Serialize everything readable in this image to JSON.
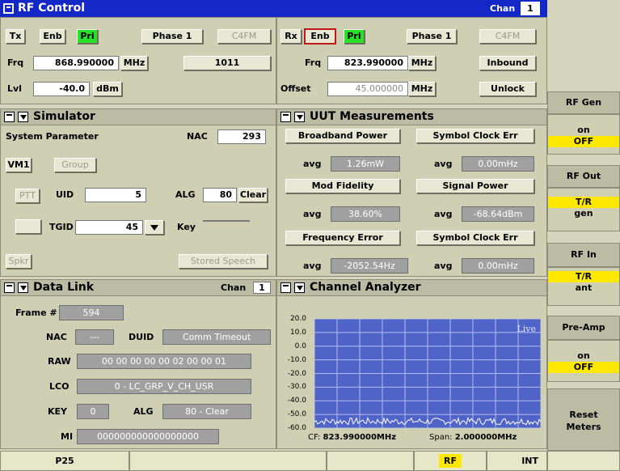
{
  "window": {
    "title": "RF Control",
    "chan_label": "Chan",
    "chan_value": "1"
  },
  "tx": {
    "label": "Tx",
    "enb": "Enb",
    "pri": "Pri",
    "phase": "Phase 1",
    "mode": "C4FM",
    "frq_label": "Frq",
    "frq_value": "868.990000",
    "frq_unit": "MHz",
    "code": "1011",
    "lvl_label": "Lvl",
    "lvl_value": "-40.0",
    "lvl_unit": "dBm"
  },
  "rx": {
    "label": "Rx",
    "enb": "Enb",
    "pri": "Pri",
    "phase": "Phase 1",
    "mode": "C4FM",
    "frq_label": "Frq",
    "frq_value": "823.990000",
    "frq_unit": "MHz",
    "inbound": "Inbound",
    "offset_label": "Offset",
    "offset_value": "45.000000",
    "offset_unit": "MHz",
    "unlock": "Unlock"
  },
  "simulator": {
    "title": "Simulator",
    "sys_param": "System Parameter",
    "nac_label": "NAC",
    "nac_value": "293",
    "vm1": "VM1",
    "group": "Group",
    "ptt": "PTT",
    "uid_label": "UID",
    "uid_value": "5",
    "alg_label": "ALG",
    "alg_value": "80",
    "clear": "Clear",
    "tgid_label": "TGID",
    "tgid_value": "45",
    "key_label": "Key",
    "key_value": "",
    "spkr": "Spkr",
    "stored_speech": "Stored Speech"
  },
  "uut": {
    "title": "UUT Measurements",
    "m1": {
      "label": "Broadband Power",
      "avg": "avg",
      "value": "1.26mW"
    },
    "m2": {
      "label": "Symbol Clock Err",
      "avg": "avg",
      "value": "0.00mHz"
    },
    "m3": {
      "label": "Mod Fidelity",
      "avg": "avg",
      "value": "38.60%"
    },
    "m4": {
      "label": "Signal Power",
      "avg": "avg",
      "value": "-68.64dBm"
    },
    "m5": {
      "label": "Frequency Error",
      "avg": "avg",
      "value": "-2052.54Hz"
    },
    "m6": {
      "label": "Symbol Clock Err",
      "avg": "avg",
      "value": "0.00mHz"
    }
  },
  "datalink": {
    "title": "Data Link",
    "chan_label": "Chan",
    "chan_value": "1",
    "frame_label": "Frame #",
    "frame_value": "594",
    "nac_label": "NAC",
    "nac_value": "---",
    "duid_label": "DUID",
    "duid_value": "Comm Timeout",
    "raw_label": "RAW",
    "raw_value": "00 00 00 00 00 02 00 00 01",
    "lco_label": "LCO",
    "lco_value": "0 - LC_GRP_V_CH_USR",
    "key_label": "KEY",
    "key_value": "0",
    "alg_label": "ALG",
    "alg_value": "80 - Clear",
    "mi_label": "MI",
    "mi_value": "000000000000000000"
  },
  "analyzer": {
    "title": "Channel Analyzer",
    "live": "Live",
    "yticks": [
      "20.0",
      "10.0",
      "0.0",
      "-10.0",
      "-20.0",
      "-30.0",
      "-40.0",
      "-50.0",
      "-60.0"
    ],
    "cf_label": "CF:",
    "cf_value": "823.990000MHz",
    "span_label": "Span:",
    "span_value": "2.000000MHz",
    "ylim": [
      -60,
      20
    ],
    "noise_floor_dbm": -55
  },
  "sidebar": {
    "rf_gen": "RF Gen",
    "rf_gen_on": "on",
    "rf_gen_off": "OFF",
    "rf_out": "RF Out",
    "rf_out_tr": "T/R",
    "rf_out_gen": "gen",
    "rf_in": "RF In",
    "rf_in_tr": "T/R",
    "rf_in_ant": "ant",
    "preamp": "Pre-Amp",
    "preamp_on": "on",
    "preamp_off": "OFF",
    "reset_meters": "Reset Meters"
  },
  "statusbar": {
    "mode": "P25",
    "rf": "RF",
    "int": "INT"
  },
  "colors": {
    "title_blue": "#1428c8",
    "pri_green": "#28e028",
    "highlight_yellow": "#ffe800",
    "graph_bg": "#5064c8",
    "grid": "#b4bcf0"
  }
}
